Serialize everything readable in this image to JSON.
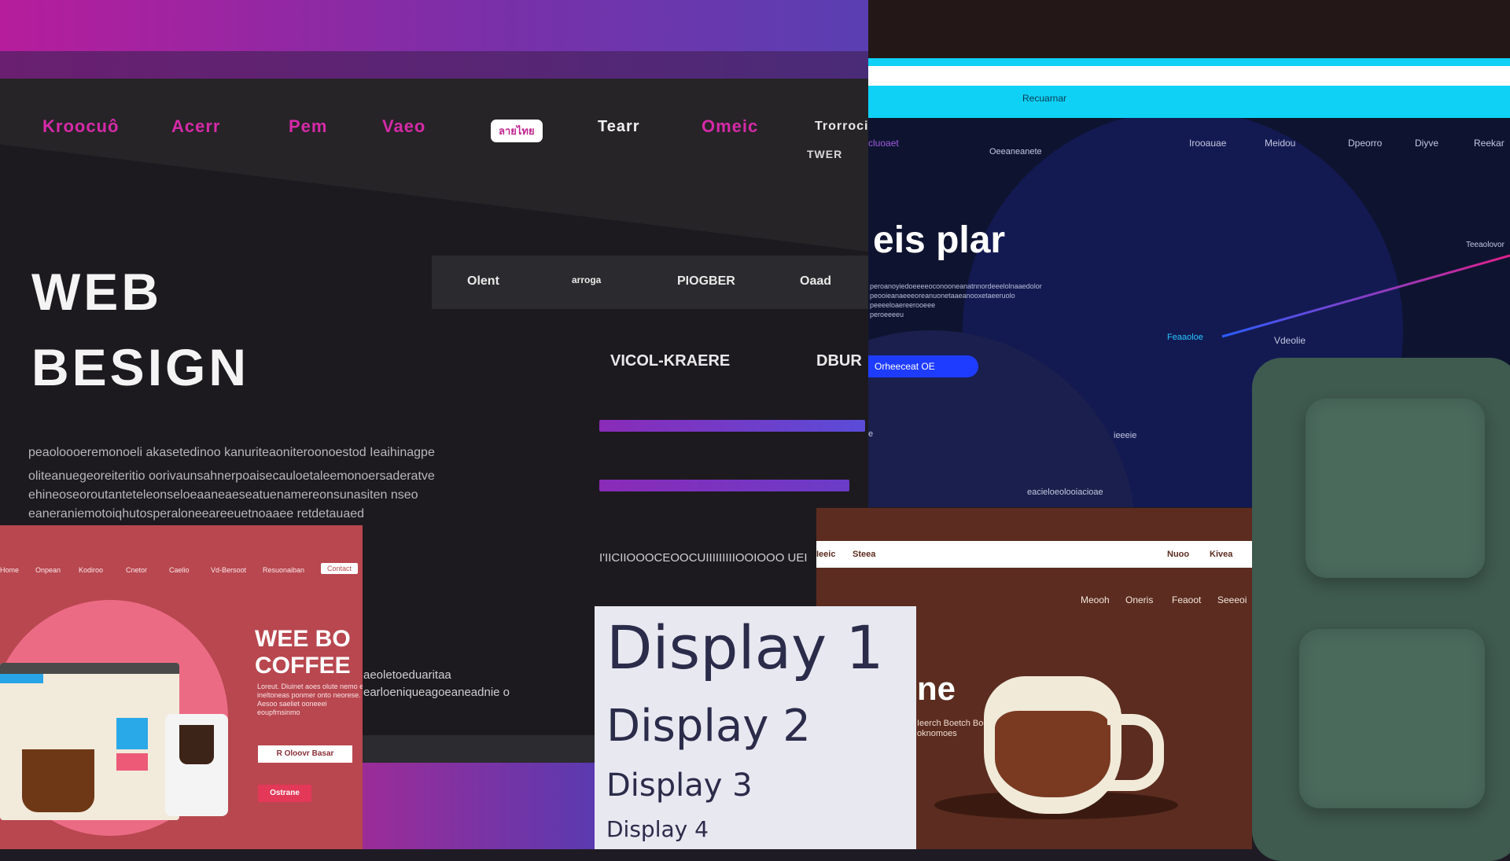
{
  "top_nav": {
    "items": [
      "Kroocuô",
      "Acerr",
      "Pem",
      "Vaeo",
      "Tearr",
      "Omeic",
      "Trorrocie"
    ],
    "pill": "ลายไทย",
    "sub": "TWER"
  },
  "hero": {
    "line1": "WEB",
    "line2": "BESIGN",
    "paragraph": [
      "peaoloooeremonoeli akasetedinoo kanuriteaoniteroonoestod Ieaihinagpe",
      "oliteanuegeoreiteritio oorivaunsahnerpoaisecauloetaleemonoersaderatve",
      "ehineoseoroutanteteleonseloeaaneaeseatuenamereonsunasiten nseo",
      "eaneraniemotoiqhutosperaloneeareeuetnoaaee retdetauaed"
    ]
  },
  "sub_nav": {
    "items": [
      "Olent",
      "arroga",
      "PIOGBER",
      "Oaad"
    ]
  },
  "side_labels": {
    "vicol": "VICOL-KRAERE",
    "dbur": "DBUR",
    "footer_text": "I'IICIIOOOCEOOCUIIIIIIIIIOOIOOO UEI",
    "bottom_text_1": "aeoletoeduaritaa",
    "bottom_text_2": "earloeniqueagoeaneadnie o"
  },
  "pink_card": {
    "nav": [
      "Home",
      "Onpean",
      "Kodiroo",
      "Cnetor",
      "Caelio",
      "Vd-Bersoot",
      "Resuonaiban"
    ],
    "nav_button": "Contact",
    "title_line1": "WEE BO",
    "title_line2": "COFFEE",
    "body": "Loreut. Diuinet aoes olute nemo et ineltoneas ponmer onto neorese. Aesoo saeliet ooneeei eoupfrnsinmo",
    "button_1": "R Oloovr Basar",
    "button_2": "Ostrane"
  },
  "navy": {
    "cyan_label": "Recuarnar",
    "nav": [
      "cluoaet",
      "Oeeaneanete",
      "Irooauae",
      "Meidou",
      "Dpeorro",
      "Diyve",
      "Reekar"
    ],
    "big_text": "eis plar",
    "body": [
      "peroanoyiedoeeeeoconooneanatnnordeeelolnaaedolor",
      "peooieanaeeeoreanuonetaaeanooxetaeeruolo",
      "peeeeloaereerooeee",
      "peroeeeeu"
    ],
    "chart_label_left": "Feaaoloe",
    "chart_label_mid": "Vdeolie",
    "chart_label_right": "Teeaolovor",
    "button": "Orheeceat OE",
    "lower_label_1": "ieeeie",
    "lower_label_2": "eacieloeolooiacioae",
    "lower_label_3": "e"
  },
  "coffee": {
    "nav_left": [
      "Ieeic",
      "Steea"
    ],
    "nav_right": [
      "Nuoo",
      "Kivea"
    ],
    "menu": [
      "Meooh",
      "Oneris",
      "Feaoot",
      "Seeeoi"
    ],
    "headline": "ne",
    "body": "Ieerch Boetch Boenes\noknomoes"
  },
  "display": {
    "d1": "Display 1",
    "d2": "Display 2",
    "d3": "Display 3",
    "d4": "Display 4"
  },
  "colors": {
    "magenta": "#d62aa8",
    "purple": "#7b2fa8",
    "cyan": "#0fd1f5",
    "navy": "#0e1430",
    "coffee": "#5b2c1f",
    "pink": "#b8474f",
    "green": "#3f5a4f"
  }
}
